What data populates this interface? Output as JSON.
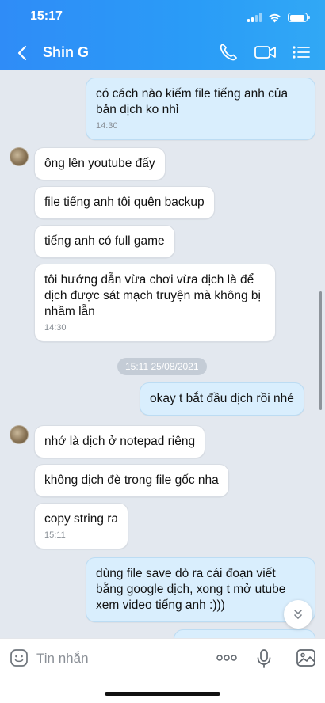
{
  "status_bar": {
    "time": "15:17",
    "battery_level_percent": 90
  },
  "header": {
    "contact_name": "Shin G",
    "accent": "#2f8cf7"
  },
  "icons": {
    "back": "chevron-left-icon",
    "call": "phone-icon",
    "video": "video-camera-icon",
    "menu": "list-menu-icon",
    "sticker": "emoji-icon",
    "more": "more-dots-icon",
    "mic": "microphone-icon",
    "image": "image-icon",
    "scroll_down": "chevron-down-double-icon"
  },
  "messages": [
    {
      "side": "out",
      "text": "có cách nào kiếm file tiếng anh của bản dịch ko nhỉ",
      "time": "14:30"
    },
    {
      "side": "in",
      "text": "ông lên youtube đấy",
      "time": ""
    },
    {
      "side": "in",
      "text": "file tiếng anh tôi quên backup",
      "time": ""
    },
    {
      "side": "in",
      "text": "tiếng anh có full game",
      "time": ""
    },
    {
      "side": "in",
      "text": "tôi hướng dẫn vừa chơi vừa dịch là để dịch được sát mạch truyện mà không bị nhầm lẫn",
      "time": "14:30"
    },
    {
      "side": "out",
      "text": "okay t bắt đầu dịch rồi nhé",
      "time": ""
    },
    {
      "side": "in",
      "text": "nhớ là dịch ở notepad riêng",
      "time": ""
    },
    {
      "side": "in",
      "text": "không dịch đè trong file gốc nha",
      "time": ""
    },
    {
      "side": "in",
      "text": "copy string ra",
      "time": "15:11"
    },
    {
      "side": "out",
      "text": "dùng file save dò ra cái đoạn viết bằng google dịch, xong t mở utube xem video tiếng anh :)))",
      "time": ""
    }
  ],
  "date_separator": "15:11 25/08/2021",
  "composer": {
    "placeholder": "Tin nhắn"
  }
}
